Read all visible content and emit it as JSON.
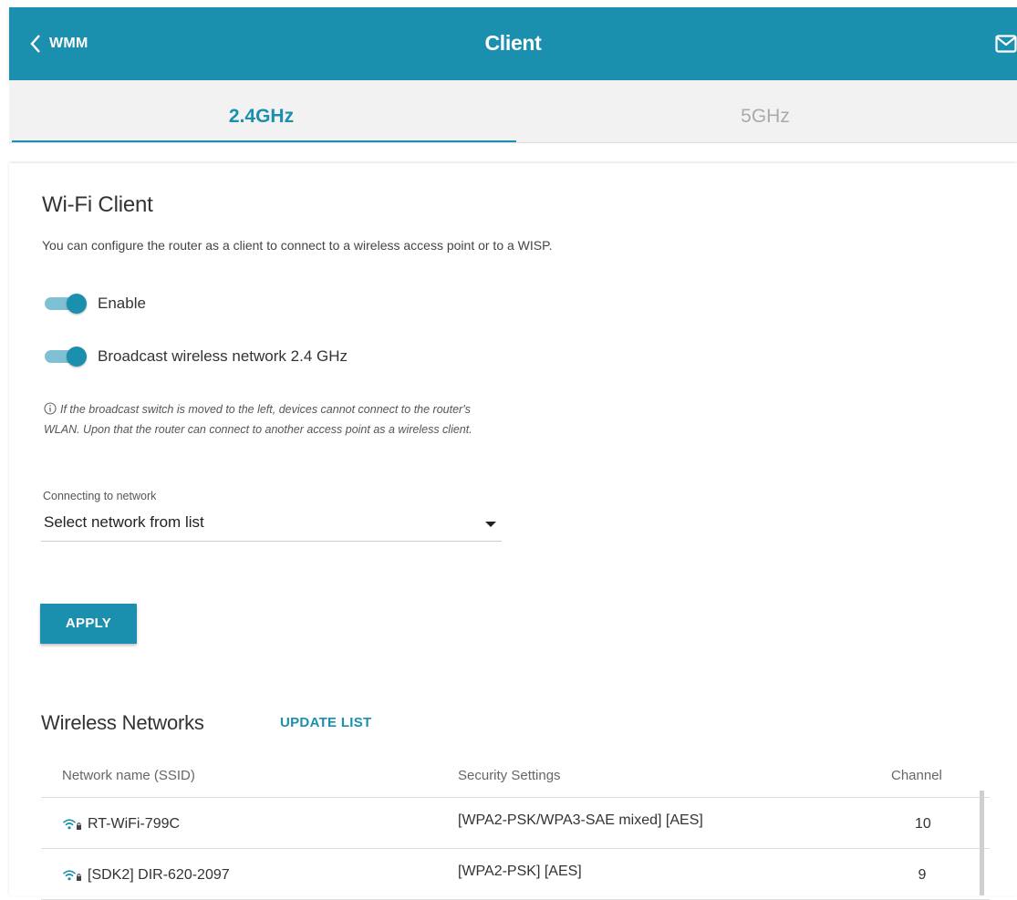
{
  "header": {
    "back_label": "WMM",
    "title": "Client"
  },
  "tabs": [
    {
      "label": "2.4GHz",
      "active": true
    },
    {
      "label": "5GHz",
      "active": false
    }
  ],
  "wifi_client": {
    "title": "Wi-Fi Client",
    "description": "You can configure the router as a client to connect to a wireless access point or to a WISP.",
    "enable_label": "Enable",
    "enable_on": true,
    "broadcast_label": "Broadcast wireless network 2.4 GHz",
    "broadcast_on": true,
    "info_text": "If the broadcast switch is moved to the left, devices cannot connect to the router's WLAN. Upon that the router can connect to another access point as a wireless client.",
    "network_field_label": "Connecting to network",
    "network_field_value": "Select network from list",
    "apply_label": "APPLY"
  },
  "wireless_networks": {
    "title": "Wireless Networks",
    "update_label": "UPDATE LIST",
    "columns": [
      "Network name (SSID)",
      "Security Settings",
      "Channel"
    ],
    "rows": [
      {
        "ssid": "RT-WiFi-799C",
        "security": "[WPA2-PSK/WPA3-SAE mixed] [AES]",
        "channel": "10"
      },
      {
        "ssid": "[SDK2] DIR-620-2097",
        "security": "[WPA2-PSK] [AES]",
        "channel": "9"
      }
    ]
  },
  "colors": {
    "accent": "#1b8fae",
    "toggle_track": "#7fc0d4"
  }
}
